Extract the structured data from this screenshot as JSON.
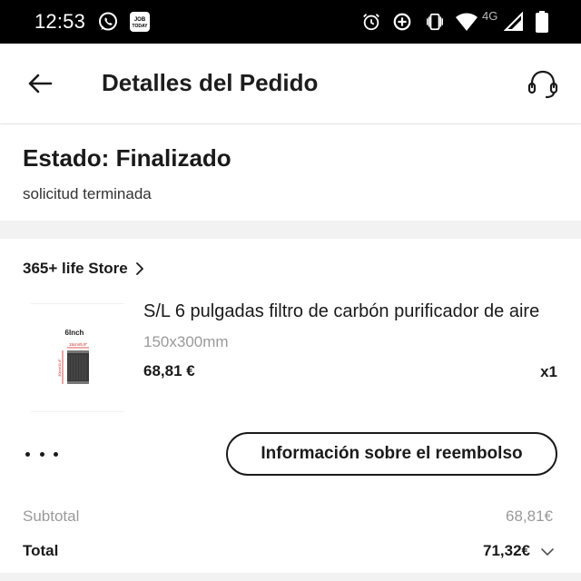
{
  "status_bar": {
    "time": "12:53",
    "network_label": "4G",
    "icons": [
      "whatsapp-icon",
      "job-today-icon",
      "alarm-icon",
      "data-saver-icon",
      "vibrate-icon",
      "wifi-icon",
      "signal-icon",
      "battery-icon"
    ],
    "job_today_text": "JOB TODAY"
  },
  "header": {
    "title": "Detalles del Pedido",
    "back_icon": "arrow-left-icon",
    "support_icon": "headset-icon"
  },
  "status": {
    "title": "Estado: Finalizado",
    "subtitle": "solicitud terminada"
  },
  "order": {
    "store_name": "365+ life Store",
    "product": {
      "name": "S/L 6 pulgadas filtro de carbón purificador de aire",
      "variant": "150x300mm",
      "price": "68,81 €",
      "quantity": "x1",
      "thumb_label": "6Inch",
      "thumb_dim_top": "15cm/5.9\"",
      "thumb_dim_side": "30cm/11.8\""
    },
    "refund_button": "Información sobre el reembolso",
    "more_icon": "more-dots-icon"
  },
  "summary": {
    "subtotal_label": "Subtotal",
    "subtotal_value": "68,81€",
    "total_label": "Total",
    "total_value": "71,32€"
  },
  "colors": {
    "status_bar": "#000000",
    "background": "#f2f2f2",
    "card": "#ffffff",
    "text_primary": "#1a1a1a",
    "text_muted": "#9a9a9a"
  }
}
